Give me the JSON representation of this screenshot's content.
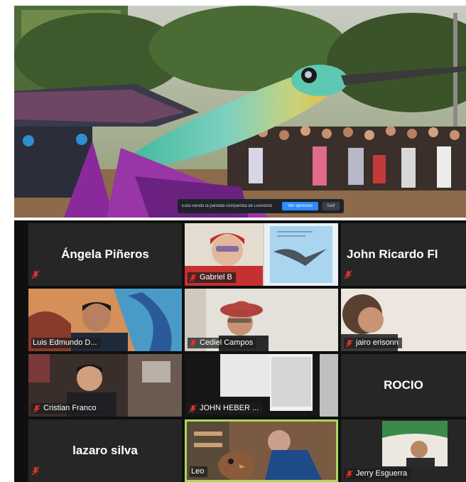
{
  "shared_screen": {
    "share_bar": {
      "message": "Está viendo la pantalla compartida de Leonardo",
      "primary_button": "Ver opciones",
      "secondary_button": "Salir"
    }
  },
  "gallery": {
    "participants": [
      {
        "name": "Ángela Piñeros",
        "video": false,
        "muted": true
      },
      {
        "name": "Gabriel B",
        "video": true,
        "muted": true
      },
      {
        "name": "John Ricardo Fl",
        "video": false,
        "muted": true
      },
      {
        "name": "Luis Edmundo D...",
        "video": true,
        "muted": false
      },
      {
        "name": "Cediel Campos",
        "video": true,
        "muted": true
      },
      {
        "name": "jairo erisonn",
        "video": true,
        "muted": true
      },
      {
        "name": "Cristian Franco",
        "video": true,
        "muted": true
      },
      {
        "name": "JOHN HEBER ...",
        "video": true,
        "muted": true
      },
      {
        "name": "ROCIO",
        "video": false,
        "muted": false
      },
      {
        "name": "lazaro silva",
        "video": false,
        "muted": true
      },
      {
        "name": "Leo",
        "video": true,
        "muted": false,
        "active_speaker": true
      },
      {
        "name": "Jerry Esguerra",
        "video": true,
        "muted": true
      }
    ]
  },
  "colors": {
    "muted_icon": "#e0322d",
    "active_speaker_border": "#a9d85a",
    "tile_bg": "#262626",
    "gallery_bg": "#0f0f0f"
  }
}
